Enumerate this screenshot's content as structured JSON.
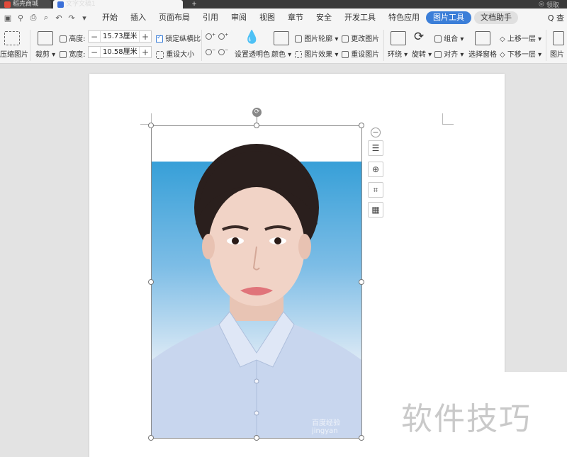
{
  "titlebar": {
    "tab_store": "稻壳商城",
    "tab_doc": "文字文稿1",
    "tab_new": "+",
    "right_label": "领取"
  },
  "quick_access": [
    "save-icon",
    "cloud-icon",
    "print-icon",
    "preview-icon",
    "undo-icon",
    "redo-icon",
    "more-icon"
  ],
  "menu": {
    "items": [
      "开始",
      "插入",
      "页面布局",
      "引用",
      "审阅",
      "视图",
      "章节",
      "安全",
      "开发工具",
      "特色应用"
    ],
    "active": "图片工具",
    "assistant": "文档助手",
    "search": "Q 查"
  },
  "ribbon": {
    "compress": "压缩图片",
    "crop": "裁剪",
    "height_label": "高度:",
    "height_value": "15.73厘米",
    "width_label": "宽度:",
    "width_value": "10.58厘米",
    "lock_ratio": "锁定纵横比",
    "reset_size": "重设大小",
    "set_transparent": "设置透明色",
    "color": "颜色",
    "picture_outline": "图片轮廓",
    "picture_effects": "图片效果",
    "change_picture": "更改图片",
    "reset_picture": "重设图片",
    "wrap": "环绕",
    "rotate": "旋转",
    "group": "组合",
    "align": "对齐",
    "selection_pane": "选择窗格",
    "bring_forward": "上移一层",
    "send_backward": "下移一层",
    "more": "图片"
  },
  "photo": {
    "watermark": "百度经验 jingyan"
  },
  "overlay_watermark": "软件技巧",
  "colors": {
    "accent": "#3b7ed8",
    "sky_top": "#38a0d8"
  }
}
